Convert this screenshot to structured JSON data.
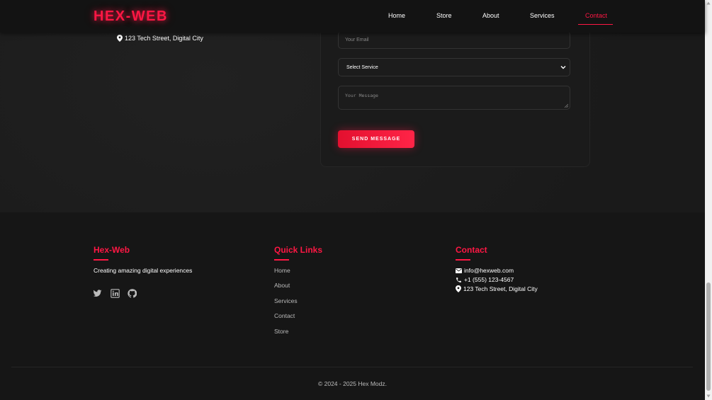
{
  "header": {
    "brand": "HEX-WEB",
    "nav": [
      {
        "label": "Home"
      },
      {
        "label": "Store"
      },
      {
        "label": "About"
      },
      {
        "label": "Services"
      },
      {
        "label": "Contact",
        "active": true
      }
    ]
  },
  "contact_info": {
    "address": "123 Tech Street, Digital City"
  },
  "contact_form": {
    "email_placeholder": "Your Email",
    "service_selected": "Select Service",
    "message_placeholder": "Your Message",
    "submit_label": "SEND MESSAGE"
  },
  "footer": {
    "about": {
      "title": "Hex-Web",
      "tagline": "Creating amazing digital experiences",
      "social_icons": [
        "twitter-icon",
        "linkedin-icon",
        "github-icon"
      ]
    },
    "quick_links": {
      "title": "Quick Links",
      "items": [
        "Home",
        "About",
        "Services",
        "Contact",
        "Store"
      ]
    },
    "contact": {
      "title": "Contact",
      "email": "info@hexweb.com",
      "phone": "+1 (555) 123-4567",
      "address": "123 Tech Street, Digital City"
    },
    "copyright": "© 2024 - 2025 Hex Modz."
  },
  "colors": {
    "accent": "#ff1744",
    "background": "#1a1a1a",
    "text": "#ffffff"
  }
}
